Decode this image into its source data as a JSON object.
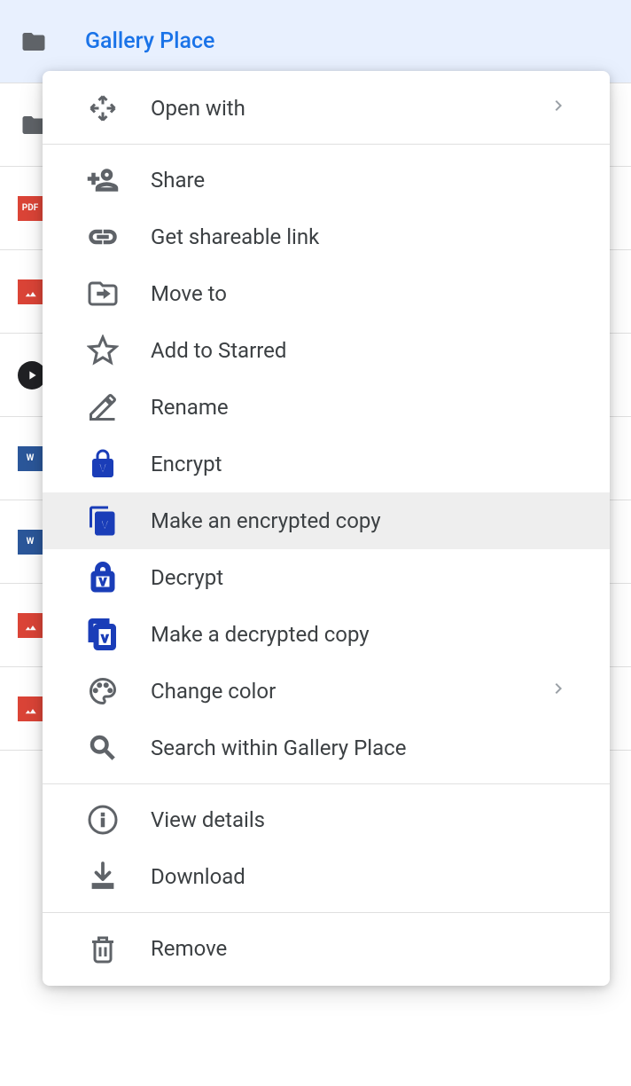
{
  "selectedFolder": {
    "name": "Gallery Place"
  },
  "backgroundRows": [
    {
      "type": "folder"
    },
    {
      "type": "pdf"
    },
    {
      "type": "image"
    },
    {
      "type": "video"
    },
    {
      "type": "word"
    },
    {
      "type": "word"
    },
    {
      "type": "image"
    },
    {
      "type": "image"
    }
  ],
  "menu": {
    "openWith": "Open with",
    "share": "Share",
    "getLink": "Get shareable link",
    "moveTo": "Move to",
    "addStar": "Add to Starred",
    "rename": "Rename",
    "encrypt": "Encrypt",
    "makeEncryptedCopy": "Make an encrypted copy",
    "decrypt": "Decrypt",
    "makeDecryptedCopy": "Make a decrypted copy",
    "changeColor": "Change color",
    "searchWithin": "Search within Gallery Place",
    "viewDetails": "View details",
    "download": "Download",
    "remove": "Remove"
  }
}
